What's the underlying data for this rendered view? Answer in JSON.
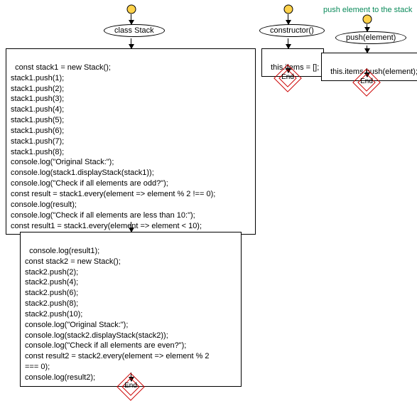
{
  "comment": "push element to the stack",
  "flows": {
    "classStack": {
      "title": "class Stack",
      "block1": "const stack1 = new Stack();\nstack1.push(1);\nstack1.push(2);\nstack1.push(3);\nstack1.push(4);\nstack1.push(5);\nstack1.push(6);\nstack1.push(7);\nstack1.push(8);\nconsole.log(\"Original Stack:\");\nconsole.log(stack1.displayStack(stack1));\nconsole.log(\"Check if all elements are odd?\");\nconst result = stack1.every(element => element % 2 !== 0);\nconsole.log(result);\nconsole.log(\"Check if all elements are less than 10:\");\nconst result1 = stack1.every(element => element < 10);",
      "block2": "console.log(result1);\nconst stack2 = new Stack();\nstack2.push(2);\nstack2.push(4);\nstack2.push(6);\nstack2.push(8);\nstack2.push(10);\nconsole.log(\"Original Stack:\");\nconsole.log(stack2.displayStack(stack2));\nconsole.log(\"Check if all elements are even?\");\nconst result2 = stack2.every(element => element % 2\n=== 0);\nconsole.log(result2);",
      "end": "End"
    },
    "constructor": {
      "title": "constructor()",
      "block": "this.items = [];",
      "end": "End"
    },
    "push": {
      "title": "push(element)",
      "block": "this.items.push(element);",
      "end": "End"
    }
  }
}
